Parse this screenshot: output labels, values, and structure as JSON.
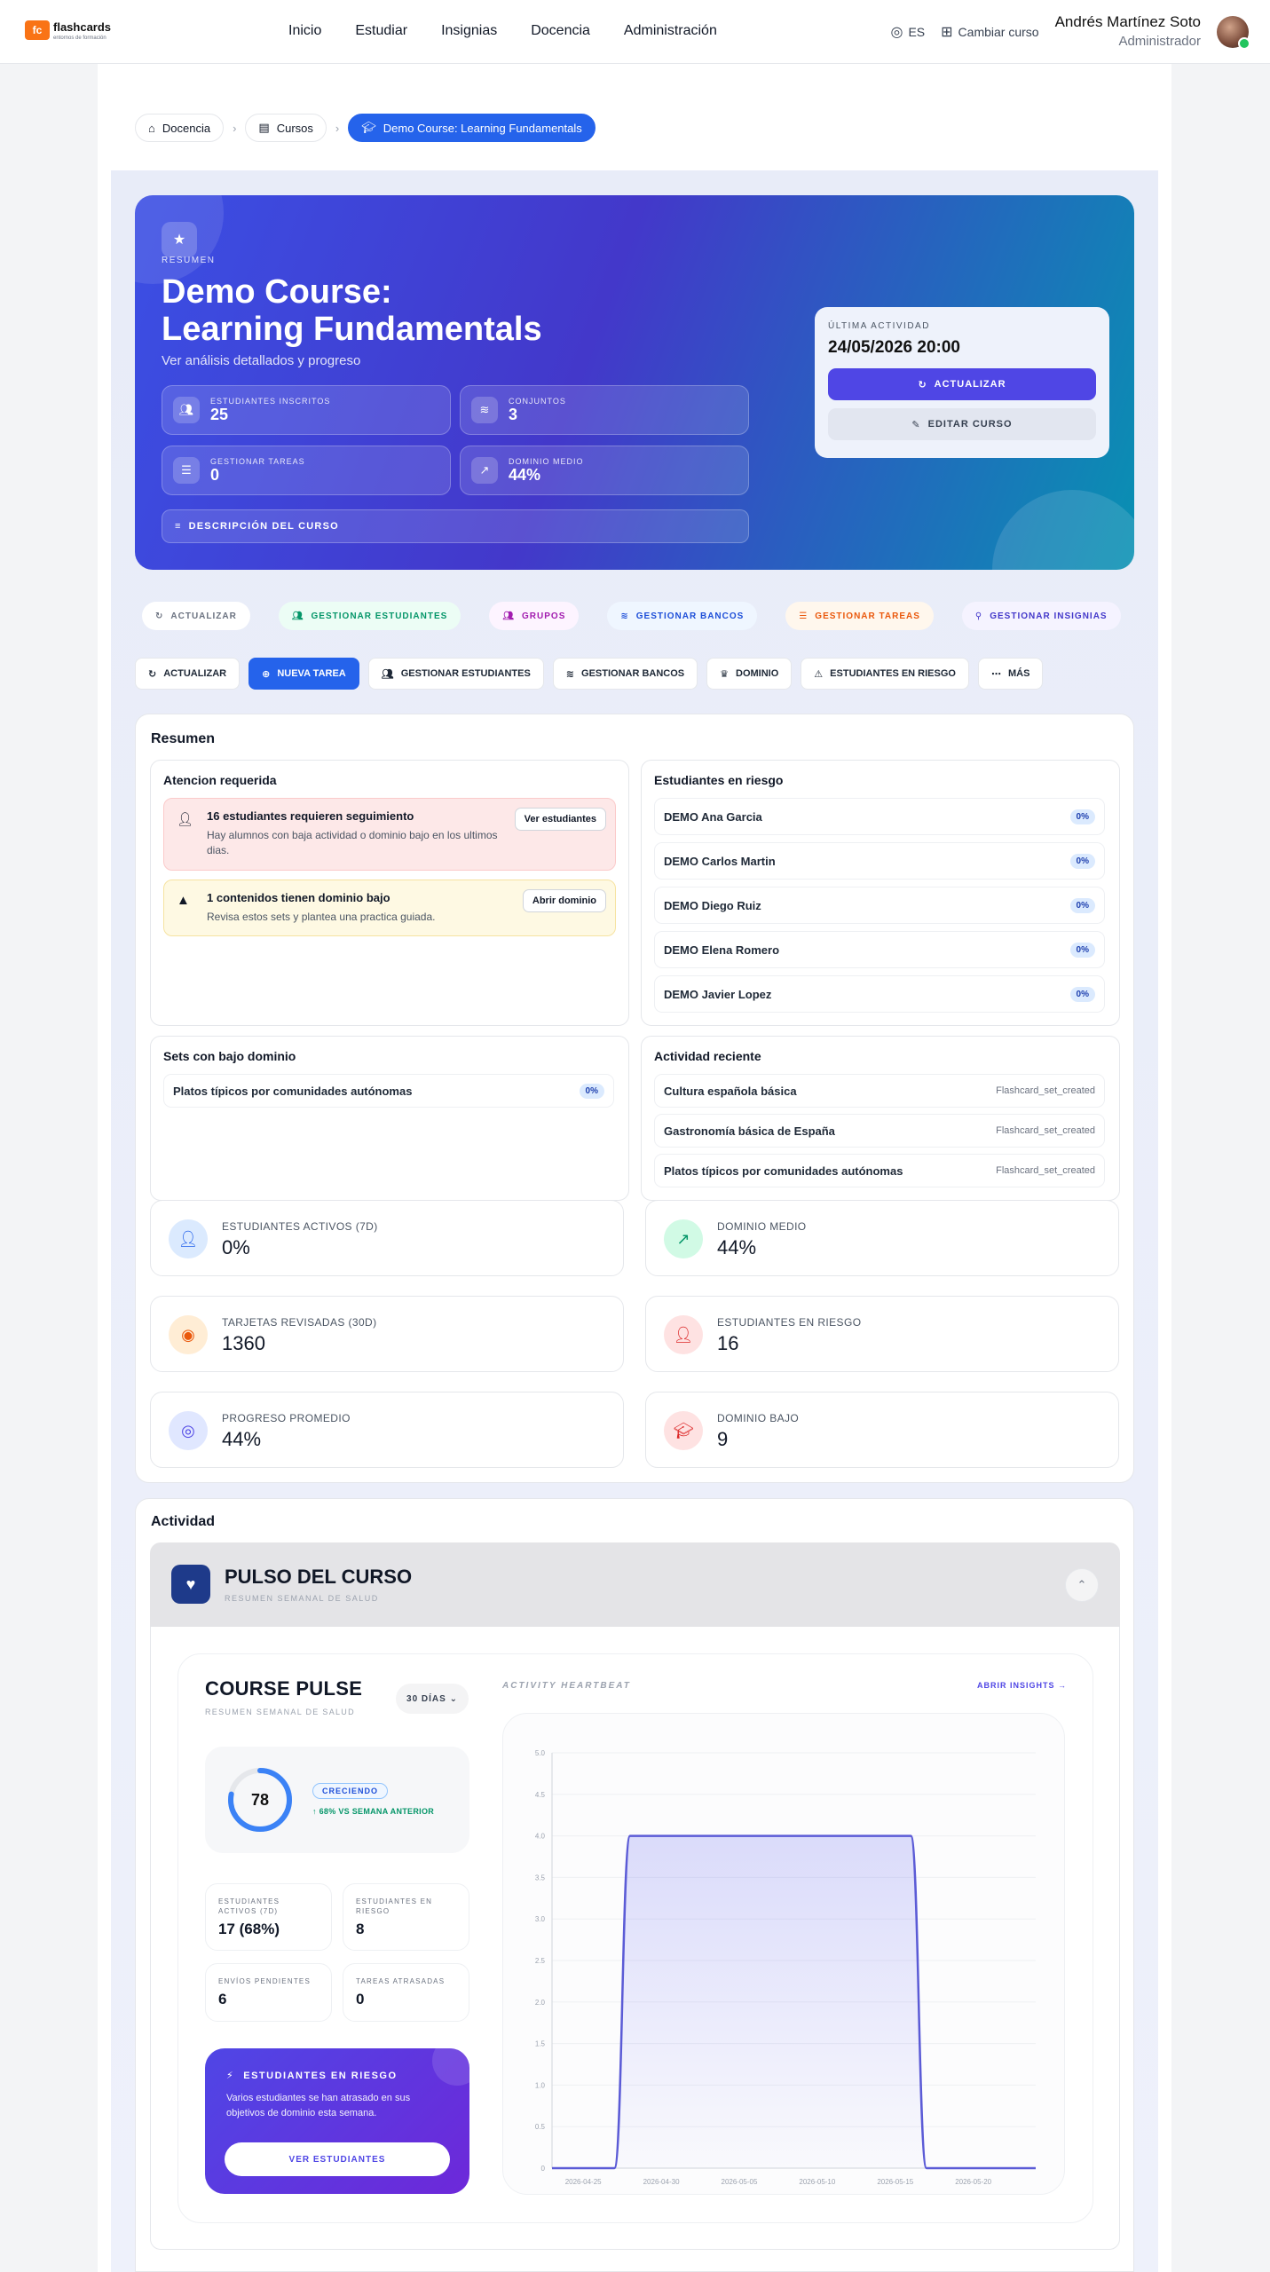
{
  "nav": {
    "logo_mark": "fc",
    "logo": "flashcards",
    "logo_sub": "entornos de formación",
    "items": [
      "Inicio",
      "Estudiar",
      "Insignias",
      "Docencia",
      "Administración"
    ],
    "lang": "ES",
    "switch": "Cambiar curso",
    "user_name": "Andrés Martínez Soto",
    "user_role": "Administrador"
  },
  "breadcrumb": [
    "Docencia",
    "Cursos",
    "Demo Course: Learning Fundamentals"
  ],
  "hero": {
    "tag": "RESUMEN",
    "title_l1": "Demo Course:",
    "title_l2": "Learning Fundamentals",
    "subtitle": "Ver análisis detallados y progreso",
    "stats": [
      {
        "label": "ESTUDIANTES INSCRITOS",
        "value": "25"
      },
      {
        "label": "CONJUNTOS",
        "value": "3"
      },
      {
        "label": "GESTIONAR TAREAS",
        "value": "0"
      },
      {
        "label": "DOMINIO MEDIO",
        "value": "44%"
      }
    ],
    "desc": "DESCRIPCIÓN DEL CURSO",
    "last_label": "ÚLTIMA ACTIVIDAD",
    "last_value": "24/05/2026 20:00",
    "refresh": "ACTUALIZAR",
    "edit": "EDITAR CURSO"
  },
  "pills": [
    "ACTUALIZAR",
    "GESTIONAR ESTUDIANTES",
    "GRUPOS",
    "GESTIONAR BANCOS",
    "GESTIONAR TAREAS",
    "GESTIONAR INSIGNIAS"
  ],
  "buttons": [
    "ACTUALIZAR",
    "NUEVA TAREA",
    "GESTIONAR ESTUDIANTES",
    "GESTIONAR BANCOS",
    "DOMINIO",
    "ESTUDIANTES EN RIESGO",
    "MÁS"
  ],
  "resumen": {
    "title": "Resumen",
    "attention": {
      "title": "Atencion requerida",
      "a1": {
        "title": "16 estudiantes requieren seguimiento",
        "desc": "Hay alumnos con baja actividad o dominio bajo en los ultimos dias.",
        "btn": "Ver estudiantes"
      },
      "a2": {
        "title": "1 contenidos tienen dominio bajo",
        "desc": "Revisa estos sets y plantea una practica guiada.",
        "btn": "Abrir dominio"
      }
    },
    "risk": {
      "title": "Estudiantes en riesgo",
      "items": [
        {
          "name": "DEMO Ana Garcia",
          "v": "0%"
        },
        {
          "name": "DEMO Carlos Martin",
          "v": "0%"
        },
        {
          "name": "DEMO Diego Ruiz",
          "v": "0%"
        },
        {
          "name": "DEMO Elena Romero",
          "v": "0%"
        },
        {
          "name": "DEMO Javier Lopez",
          "v": "0%"
        }
      ]
    },
    "low": {
      "title": "Sets con bajo dominio",
      "items": [
        {
          "name": "Platos típicos por comunidades autónomas",
          "v": "0%"
        }
      ]
    },
    "recent": {
      "title": "Actividad reciente",
      "items": [
        {
          "name": "Cultura española básica",
          "type": "Flashcard_set_created"
        },
        {
          "name": "Gastronomía básica de España",
          "type": "Flashcard_set_created"
        },
        {
          "name": "Platos típicos por comunidades autónomas",
          "type": "Flashcard_set_created"
        }
      ]
    },
    "kpis": [
      {
        "label": "ESTUDIANTES ACTIVOS (7D)",
        "value": "0%"
      },
      {
        "label": "DOMINIO MEDIO",
        "value": "44%"
      },
      {
        "label": "TARJETAS REVISADAS (30D)",
        "value": "1360"
      },
      {
        "label": "ESTUDIANTES EN RIESGO",
        "value": "16"
      },
      {
        "label": "PROGRESO PROMEDIO",
        "value": "44%"
      },
      {
        "label": "DOMINIO BAJO",
        "value": "9"
      }
    ]
  },
  "actividad": {
    "title": "Actividad",
    "pulse_title": "PULSO DEL CURSO",
    "pulse_sub": "RESUMEN SEMANAL DE SALUD",
    "cp_title": "COURSE PULSE",
    "cp_sub": "RESUMEN SEMANAL DE SALUD",
    "days": "30 DÍAS",
    "score": "78",
    "score_fraction": 0.78,
    "trend": "CRECIENDO",
    "trend_val": "↑ 68% VS SEMANA ANTERIOR",
    "minis": [
      {
        "label": "ESTUDIANTES ACTIVOS (7D)",
        "value": "17 (68%)"
      },
      {
        "label": "ESTUDIANTES EN RIESGO",
        "value": "8"
      },
      {
        "label": "ENVÍOS PENDIENTES",
        "value": "6"
      },
      {
        "label": "TAREAS ATRASADAS",
        "value": "0"
      }
    ],
    "risk_title": "ESTUDIANTES EN RIESGO",
    "risk_desc": "Varios estudiantes se han atrasado en sus objetivos de dominio esta semana.",
    "risk_btn": "VER ESTUDIANTES",
    "heartbeat": "ACTIVITY HEARTBEAT",
    "insights": "ABRIR INSIGHTS →"
  },
  "chart_data": {
    "type": "area",
    "xlabel": "",
    "ylabel": "",
    "ylim": [
      0,
      5
    ],
    "yticks": [
      "0",
      "0.5",
      "1.0",
      "1.5",
      "2.0",
      "2.5",
      "3.0",
      "3.5",
      "4.0",
      "4.5",
      "5.0"
    ],
    "xticks": [
      "2026-04-25",
      "2026-04-30",
      "2026-05-05",
      "2026-05-10",
      "2026-05-15",
      "2026-05-20"
    ],
    "x": [
      "2026-04-23",
      "2026-04-24",
      "2026-04-25",
      "2026-04-26",
      "2026-04-27",
      "2026-04-28",
      "2026-04-29",
      "2026-04-30",
      "2026-05-01",
      "2026-05-02",
      "2026-05-03",
      "2026-05-04",
      "2026-05-05",
      "2026-05-06",
      "2026-05-07",
      "2026-05-08",
      "2026-05-09",
      "2026-05-10",
      "2026-05-11",
      "2026-05-12",
      "2026-05-13",
      "2026-05-14",
      "2026-05-15",
      "2026-05-16",
      "2026-05-17",
      "2026-05-18",
      "2026-05-19",
      "2026-05-20",
      "2026-05-21",
      "2026-05-22",
      "2026-05-23",
      "2026-05-24"
    ],
    "values": [
      0,
      0,
      0,
      0,
      0,
      4,
      4,
      4,
      4,
      4,
      4,
      4,
      4,
      4,
      4,
      4,
      4,
      4,
      4,
      4,
      4,
      4,
      4,
      4,
      0,
      0,
      0,
      0,
      0,
      0,
      0,
      0
    ],
    "color": "#5b5bd6",
    "grid": true
  }
}
